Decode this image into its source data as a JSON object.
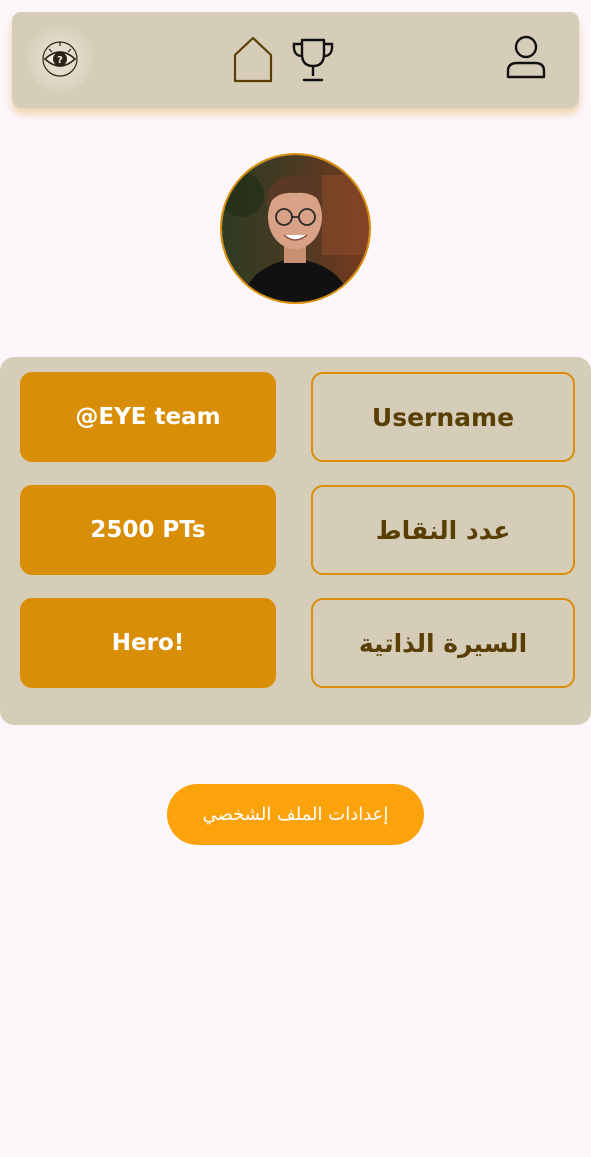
{
  "header": {
    "logo_icon": "eye-logo-icon",
    "nav": [
      {
        "name": "home",
        "icon": "house-icon"
      },
      {
        "name": "leaderboard",
        "icon": "trophy-icon"
      },
      {
        "name": "profile",
        "icon": "user-icon"
      }
    ]
  },
  "avatar": {
    "description_icon": "avatar-photo"
  },
  "profile": {
    "rows": [
      {
        "label": "Username",
        "value": "@EYE team"
      },
      {
        "label": "عدد النقاط",
        "value": "2500 PTs"
      },
      {
        "label": "السيرة الذاتية",
        "value": "Hero!"
      }
    ]
  },
  "settings_button": {
    "label": "إعدادات الملف الشخصي"
  },
  "colors": {
    "background": "#fdf6fb",
    "panel": "#d6cdb9",
    "accent": "#d98e07",
    "button": "#fca30b",
    "label_text": "#5a3f05"
  }
}
